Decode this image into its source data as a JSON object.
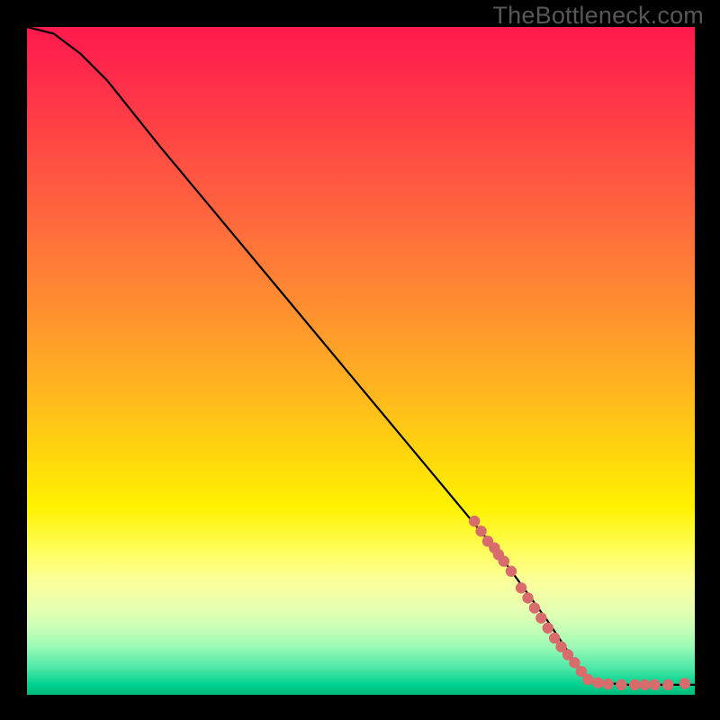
{
  "watermark": "TheBottleneck.com",
  "colors": {
    "page_bg": "#000000",
    "watermark": "#575757",
    "curve": "#000000",
    "points": "#d86b6b",
    "gradient_top": "#ff1a4d",
    "gradient_mid": "#ffe400",
    "gradient_bottom": "#00bb7a"
  },
  "chart_data": {
    "type": "line",
    "title": "",
    "xlabel": "",
    "ylabel": "",
    "xlim": [
      0,
      100
    ],
    "ylim": [
      0,
      100
    ],
    "note": "Axes are unlabeled in the image; x/y here is a 0–100 normalized viewport (origin at bottom-left). Curve descends from ~y=100 at x=0 with a slight shoulder, then nearly linear down to ~(84, 2), then flattens along the bottom to x=100.",
    "curve": [
      {
        "x": 0,
        "y": 100
      },
      {
        "x": 4,
        "y": 99
      },
      {
        "x": 8,
        "y": 96
      },
      {
        "x": 12,
        "y": 92
      },
      {
        "x": 20,
        "y": 82
      },
      {
        "x": 30,
        "y": 70
      },
      {
        "x": 40,
        "y": 58
      },
      {
        "x": 50,
        "y": 46
      },
      {
        "x": 60,
        "y": 34
      },
      {
        "x": 70,
        "y": 22
      },
      {
        "x": 78,
        "y": 11
      },
      {
        "x": 84,
        "y": 2
      },
      {
        "x": 90,
        "y": 1.5
      },
      {
        "x": 96,
        "y": 1.5
      },
      {
        "x": 100,
        "y": 1.5
      }
    ],
    "highlighted_points": [
      {
        "x": 67,
        "y": 26
      },
      {
        "x": 68,
        "y": 24.5
      },
      {
        "x": 69,
        "y": 23
      },
      {
        "x": 70,
        "y": 22
      },
      {
        "x": 70.6,
        "y": 21
      },
      {
        "x": 71.4,
        "y": 20
      },
      {
        "x": 72.5,
        "y": 18.5
      },
      {
        "x": 74,
        "y": 16
      },
      {
        "x": 75,
        "y": 14.5
      },
      {
        "x": 76,
        "y": 13
      },
      {
        "x": 77,
        "y": 11.5
      },
      {
        "x": 78,
        "y": 10
      },
      {
        "x": 79,
        "y": 8.5
      },
      {
        "x": 80,
        "y": 7.2
      },
      {
        "x": 81,
        "y": 6
      },
      {
        "x": 82,
        "y": 4.8
      },
      {
        "x": 83,
        "y": 3.5
      },
      {
        "x": 84,
        "y": 2.3
      },
      {
        "x": 85.5,
        "y": 1.8
      },
      {
        "x": 87,
        "y": 1.6
      },
      {
        "x": 89,
        "y": 1.5
      },
      {
        "x": 91,
        "y": 1.5
      },
      {
        "x": 92.5,
        "y": 1.5
      },
      {
        "x": 94,
        "y": 1.5
      },
      {
        "x": 96,
        "y": 1.5
      },
      {
        "x": 98.5,
        "y": 1.7
      }
    ]
  }
}
